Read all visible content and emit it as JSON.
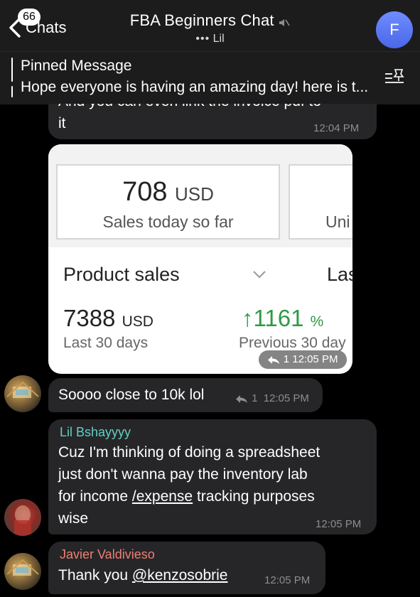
{
  "header": {
    "back_label": "Chats",
    "unread_badge": "66",
    "title": "FBA Beginners Chat",
    "subtitle": "Lil",
    "typing_dots": "•••",
    "avatar_letter": "F"
  },
  "pinned": {
    "title": "Pinned Message",
    "text": "Hope everyone is having an amazing day! here is t..."
  },
  "messages": {
    "m1": {
      "partial_top": "And you can even link the invoice pdf to",
      "text": "it",
      "time": "12:04 PM"
    },
    "card": {
      "sales_amount": "708",
      "sales_unit": "USD",
      "sales_label": "Sales today so far",
      "second_label": "Uni",
      "product_sales": "Product sales",
      "last_partial": "Las",
      "total_amount": "7388",
      "total_unit": "USD",
      "total_period": "Last 30 days",
      "growth_arrow": "↑",
      "growth_value": "1161",
      "growth_unit": "%",
      "prev_period": "Previous 30 day",
      "reply_count": "1",
      "time": "12:05 PM"
    },
    "m2": {
      "text": "Soooo close to 10k lol",
      "reply_count": "1",
      "time": "12:05 PM"
    },
    "m3": {
      "sender": "Lil Bshayyyy",
      "sender_color": "#5fd0c4",
      "line1": "Cuz I'm thinking of doing a spreadsheet",
      "line2": "just don't wanna pay the inventory lab",
      "line3_pre": "for income ",
      "line3_link": "/expense",
      "line3_post": " tracking purposes",
      "line4": "wise",
      "time": "12:05 PM"
    },
    "m4": {
      "sender": "Javier Valdivieso",
      "sender_color": "#f07f74",
      "text_pre": "Thank you ",
      "mention": "@kenzosobrie",
      "time": "12:05 PM"
    }
  },
  "colors": {
    "background": "#000000",
    "bubble": "#262628",
    "header": "#1c1c1d",
    "avatar_gradient": "#5b78f5",
    "growth_green": "#2e9a47"
  }
}
